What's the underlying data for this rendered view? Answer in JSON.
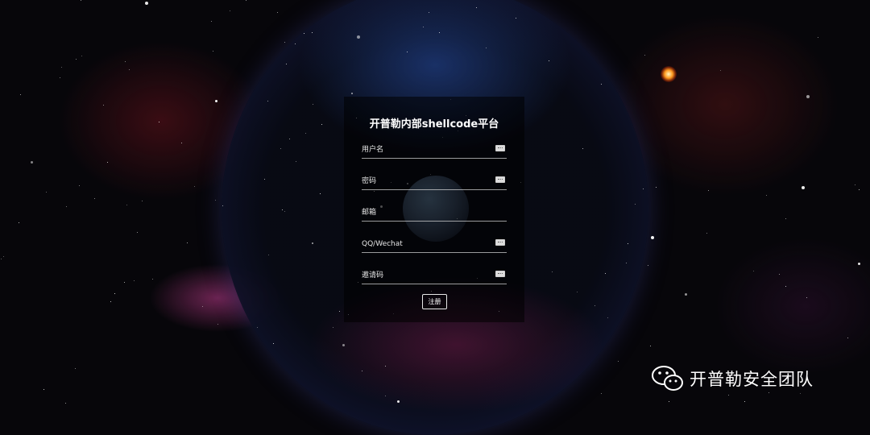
{
  "form": {
    "title": "开普勒内部shellcode平台",
    "fields": [
      {
        "placeholder": "用户名",
        "value": ""
      },
      {
        "placeholder": "密码",
        "value": ""
      },
      {
        "placeholder": "邮箱",
        "value": ""
      },
      {
        "placeholder": "QQ/Wechat",
        "value": ""
      },
      {
        "placeholder": "邀请码",
        "value": ""
      }
    ],
    "submit_label": "注册"
  },
  "watermark": {
    "text": "开普勒安全团队",
    "icon": "wechat-icon"
  },
  "colors": {
    "accent_sun": "#ff9a20",
    "text": "#ffffff",
    "background": "#07060a"
  }
}
